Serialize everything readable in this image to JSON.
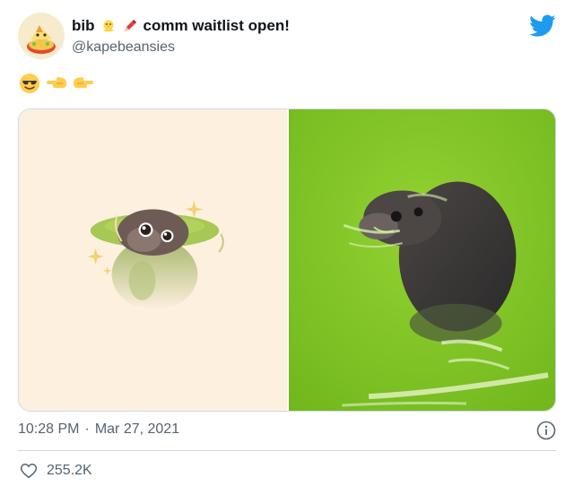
{
  "author": {
    "display_name_prefix": "bib",
    "display_name_suffix": "comm waitlist open!",
    "handle": "@kapebeansies"
  },
  "header_icons": [
    "avatar",
    "chick-emoji",
    "pen-emoji",
    "twitter-bird-icon"
  ],
  "tweet_text_emojis": [
    "smiling-face-with-sunglasses-emoji",
    "backhand-index-pointing-left-emoji",
    "backhand-index-pointing-right-emoji"
  ],
  "media": {
    "left": "seal-illustration",
    "right": "seal-photo"
  },
  "meta": {
    "time": "10:28 PM",
    "separator": "·",
    "date": "Mar 27, 2021"
  },
  "engagement": {
    "likes": "255.2K"
  },
  "colors": {
    "accent": "#1d9bf0",
    "secondary_text": "#536471",
    "divider": "#cfd9de",
    "photo_water": "#8ccc2c",
    "illustration_bg": "#fdf0df"
  }
}
